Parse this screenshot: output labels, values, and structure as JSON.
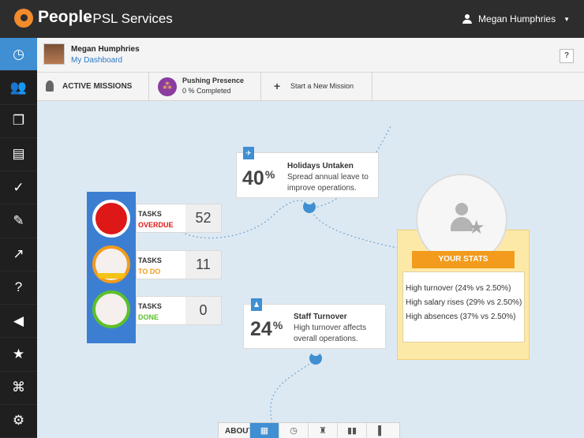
{
  "header": {
    "logo_text": "People",
    "brand_sub": "- PSL Services",
    "user_name": "Megan Humphries"
  },
  "sidebar": {
    "items": [
      {
        "icon": "clock-icon",
        "label": "◷"
      },
      {
        "icon": "team-icon",
        "label": "👥"
      },
      {
        "icon": "copy-icon",
        "label": "❐"
      },
      {
        "icon": "book-icon",
        "label": "▤"
      },
      {
        "icon": "check-icon",
        "label": "✓"
      },
      {
        "icon": "pin-icon",
        "label": "✎"
      },
      {
        "icon": "chart-icon",
        "label": "↗"
      },
      {
        "icon": "document-icon",
        "label": "?"
      },
      {
        "icon": "megaphone-icon",
        "label": "◀"
      },
      {
        "icon": "star-icon",
        "label": "★"
      },
      {
        "icon": "org-chart-icon",
        "label": "⌘"
      },
      {
        "icon": "settings-icon",
        "label": "⚙"
      }
    ]
  },
  "profile": {
    "name": "Megan Humphries",
    "dashboard_link": "My Dashboard",
    "help_label": "?"
  },
  "missions": {
    "active_label": "ACTIVE MISSIONS",
    "current_title": "Pushing Presence",
    "current_progress": "0 % Completed",
    "start_label": "Start a New Mission"
  },
  "tasks": [
    {
      "label": "TASKS",
      "state": "OVERDUE",
      "count": "52"
    },
    {
      "label": "TASKS",
      "state": "TO DO",
      "count": "11"
    },
    {
      "label": "TASKS",
      "state": "DONE",
      "count": "0"
    }
  ],
  "cards": [
    {
      "icon": "✈",
      "percent": "40",
      "percent_sign": "%",
      "title": "Holidays Untaken",
      "description": "Spread annual leave to improve operations."
    },
    {
      "icon": "♟",
      "percent": "24",
      "percent_sign": "%",
      "title": "Staff Turnover",
      "description": "High turnover affects overall operations."
    }
  ],
  "stats": {
    "title": "YOUR STATS",
    "items": [
      "High turnover (24% vs 2.50%)",
      "High salary rises (29% vs 2.50%)",
      "High absences (37% vs 2.50%)"
    ]
  },
  "about": {
    "label": "ABOUT",
    "tabs": [
      {
        "icon": "grid-icon",
        "glyph": "▦"
      },
      {
        "icon": "clock-icon",
        "glyph": "◷"
      },
      {
        "icon": "tower-icon",
        "glyph": "♜"
      },
      {
        "icon": "people-icon",
        "glyph": "▮▮"
      },
      {
        "icon": "person-icon",
        "glyph": "▌"
      }
    ]
  }
}
